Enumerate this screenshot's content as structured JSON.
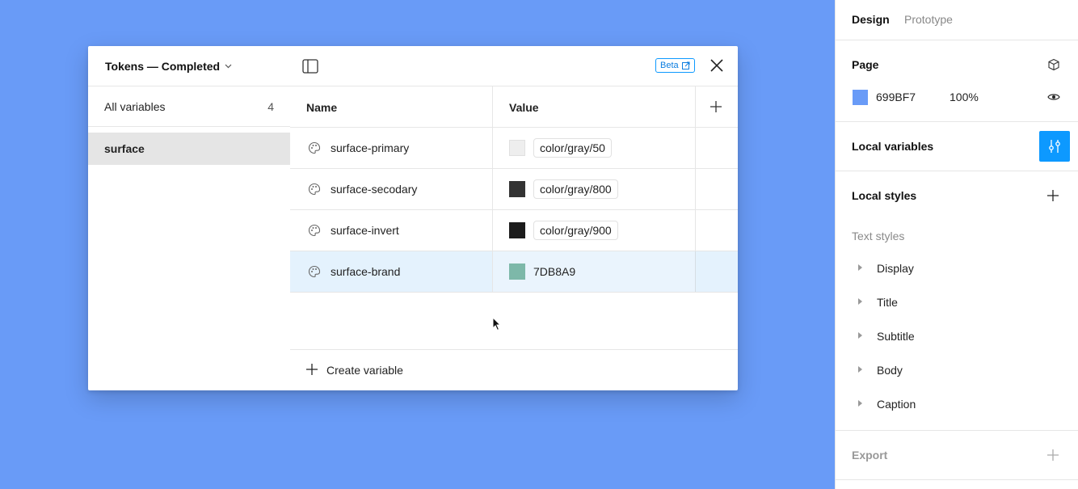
{
  "colors": {
    "canvas": "#699BF7",
    "accent": "#0d99ff"
  },
  "modal": {
    "collection_title": "Tokens — Completed",
    "beta_label": "Beta",
    "sidebar": {
      "all_variables_label": "All variables",
      "all_variables_count": "4",
      "groups": [
        {
          "label": "surface",
          "selected": true
        }
      ]
    },
    "table": {
      "columns": [
        "Name",
        "Value"
      ],
      "rows": [
        {
          "name": "surface-primary",
          "swatch": "#eeeeee",
          "value": "color/gray/50",
          "alias": true
        },
        {
          "name": "surface-secodary",
          "swatch": "#333333",
          "value": "color/gray/800",
          "alias": true
        },
        {
          "name": "surface-invert",
          "swatch": "#1c1c1c",
          "value": "color/gray/900",
          "alias": true
        },
        {
          "name": "surface-brand",
          "swatch": "#7DB8A9",
          "value": "7DB8A9",
          "alias": false,
          "selected": true
        }
      ],
      "create_label": "Create variable"
    }
  },
  "right_panel": {
    "tabs": [
      "Design",
      "Prototype"
    ],
    "active_tab": "Design",
    "page": {
      "title": "Page",
      "color_hex": "699BF7",
      "opacity": "100%",
      "swatch": "#699BF7"
    },
    "local_variables": {
      "title": "Local variables"
    },
    "local_styles": {
      "title": "Local styles",
      "text_styles_label": "Text styles",
      "items": [
        "Display",
        "Title",
        "Subtitle",
        "Body",
        "Caption"
      ]
    },
    "export": {
      "title": "Export"
    }
  }
}
